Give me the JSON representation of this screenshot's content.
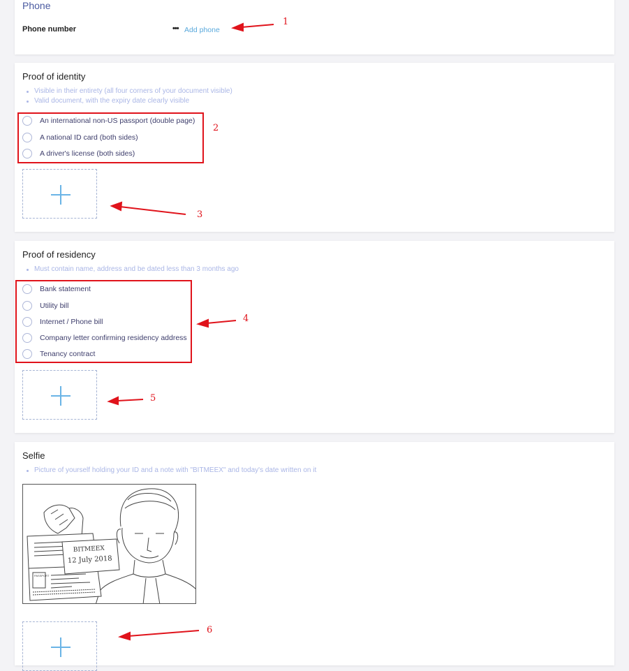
{
  "phone": {
    "title": "Phone",
    "field_label": "Phone number",
    "value_dots": "•••",
    "add_link": "Add phone"
  },
  "identity": {
    "title": "Proof of identity",
    "bullets": [
      "Visible in their entirety (all four corners of your document visible)",
      "Valid document, with the expiry date clearly visible"
    ],
    "options": [
      "An international non-US passport (double page)",
      "A national ID card (both sides)",
      "A driver's license (both sides)"
    ]
  },
  "residency": {
    "title": "Proof of residency",
    "bullets": [
      "Must contain name, address and be dated less than 3 months ago"
    ],
    "options": [
      "Bank statement",
      "Utility bill",
      "Internet / Phone bill",
      "Company letter confirming residency address",
      "Tenancy contract"
    ]
  },
  "selfie": {
    "title": "Selfie",
    "bullets": [
      "Picture of yourself holding your ID and a note with \"BITMEEX\" and today's date written on it"
    ],
    "illustration": {
      "note_line1": "BITMEEX",
      "note_line2": "12 July 2018",
      "doc_label": "PASSPORT"
    }
  },
  "annotations": [
    "1",
    "2",
    "3",
    "4",
    "5",
    "6"
  ],
  "colors": {
    "annotation_red": "#e0131b",
    "link_blue": "#5aa9dc",
    "bullet_blue": "#aab6e6",
    "plus_blue": "#6ab4e6"
  }
}
